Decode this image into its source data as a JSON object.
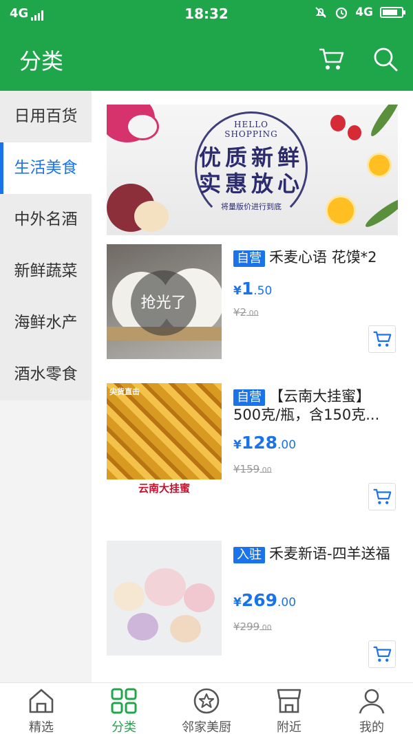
{
  "status_bar": {
    "network": "4G",
    "time": "18:32",
    "network_right": "4G"
  },
  "header": {
    "title": "分类",
    "cart_icon": "cart-icon",
    "search_icon": "search-icon"
  },
  "colors": {
    "primary_green": "#1fa64a",
    "accent_blue": "#1a73e8",
    "muted": "#999999"
  },
  "sidebar": {
    "items": [
      {
        "label": "日用百货",
        "active": false
      },
      {
        "label": "生活美食",
        "active": true
      },
      {
        "label": "中外名酒",
        "active": false
      },
      {
        "label": "新鲜蔬菜",
        "active": false
      },
      {
        "label": "海鲜水产",
        "active": false
      },
      {
        "label": "酒水零食",
        "active": false
      }
    ]
  },
  "banner": {
    "hello": "HELLO",
    "shopping": "SHOPPING",
    "line1": "优质新鲜",
    "line2": "实惠放心",
    "sub": "将量版价进行到底"
  },
  "products": [
    {
      "tag": "自营",
      "title": "禾麦心语 花馍*2",
      "currency": "¥",
      "price_int": "1",
      "price_dec": ".50",
      "old_int": "¥2",
      "old_dec": ".00",
      "overlay": "抢光了"
    },
    {
      "tag": "自营",
      "title": "【云南大挂蜜】500克/瓶，含150克...",
      "currency": "¥",
      "price_int": "128",
      "price_dec": ".00",
      "old_int": "¥159",
      "old_dec": ".00",
      "caption": "云南大挂蜜",
      "badge": "尖货直击"
    },
    {
      "tag": "入驻",
      "title": "禾麦新语-四羊送福",
      "currency": "¥",
      "price_int": "269",
      "price_dec": ".00",
      "old_int": "¥299",
      "old_dec": ".00"
    }
  ],
  "tabbar": {
    "items": [
      {
        "label": "精选",
        "icon": "home-icon",
        "active": false
      },
      {
        "label": "分类",
        "icon": "grid-icon",
        "active": true
      },
      {
        "label": "邻家美厨",
        "icon": "star-circle-icon",
        "active": false
      },
      {
        "label": "附近",
        "icon": "store-icon",
        "active": false
      },
      {
        "label": "我的",
        "icon": "user-icon",
        "active": false
      }
    ]
  }
}
